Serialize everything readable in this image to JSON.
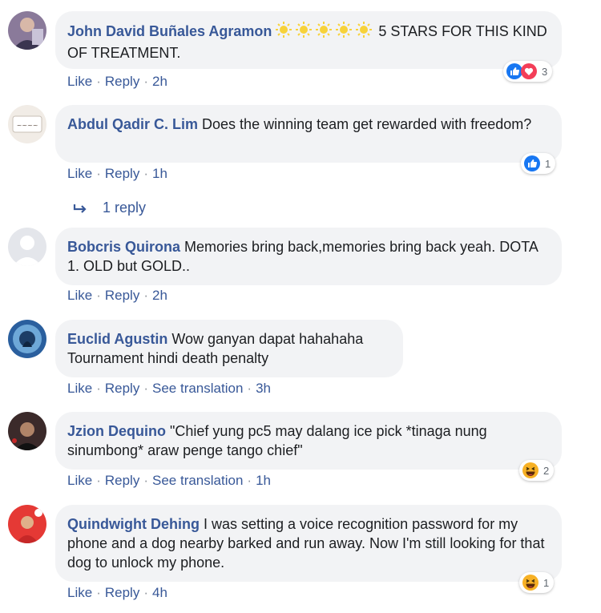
{
  "colors": {
    "author": "#385898",
    "bubble": "#f2f3f5",
    "meta": "#90949c",
    "like_blue": "#1877f2",
    "love_red": "#f33e58",
    "haha_yellow": "#f7b125"
  },
  "comments": [
    {
      "author": "John David Buñales Agramon",
      "text": "5 STARS FOR THIS KIND OF TREATMENT.",
      "rating_icons": 5,
      "like": "Like",
      "reply": "Reply",
      "time": "2h",
      "reactions": {
        "icons": [
          "like-icon",
          "love-icon"
        ],
        "count": "3"
      }
    },
    {
      "author": "Abdul Qadir C. Lim",
      "text": "Does the winning team get rewarded with freedom?",
      "like": "Like",
      "reply": "Reply",
      "time": "1h",
      "reactions": {
        "icons": [
          "like-icon"
        ],
        "count": "1"
      },
      "replies_link": "1 reply"
    },
    {
      "author": "Bobcris Quirona",
      "text": "Memories bring back,memories bring back yeah. DOTA 1. OLD but GOLD..",
      "like": "Like",
      "reply": "Reply",
      "time": "2h"
    },
    {
      "author": "Euclid Agustin",
      "text": "Wow ganyan dapat hahahaha Tournament hindi death penalty",
      "like": "Like",
      "reply": "Reply",
      "see_translation": "See translation",
      "time": "3h"
    },
    {
      "author": "Jzion Dequino",
      "text": "\"Chief yung pc5 may dalang ice pick *tinaga nung sinumbong* araw penge tango chief\"",
      "like": "Like",
      "reply": "Reply",
      "see_translation": "See translation",
      "time": "1h",
      "reactions": {
        "icons": [
          "haha-icon"
        ],
        "count": "2"
      }
    },
    {
      "author": "Quindwight Dehing",
      "text": "I was setting a voice recognition password for my phone and a dog nearby barked and run away. Now I'm still looking for that dog to unlock my phone.",
      "like": "Like",
      "reply": "Reply",
      "time": "4h",
      "reactions": {
        "icons": [
          "haha-icon"
        ],
        "count": "1"
      }
    }
  ]
}
